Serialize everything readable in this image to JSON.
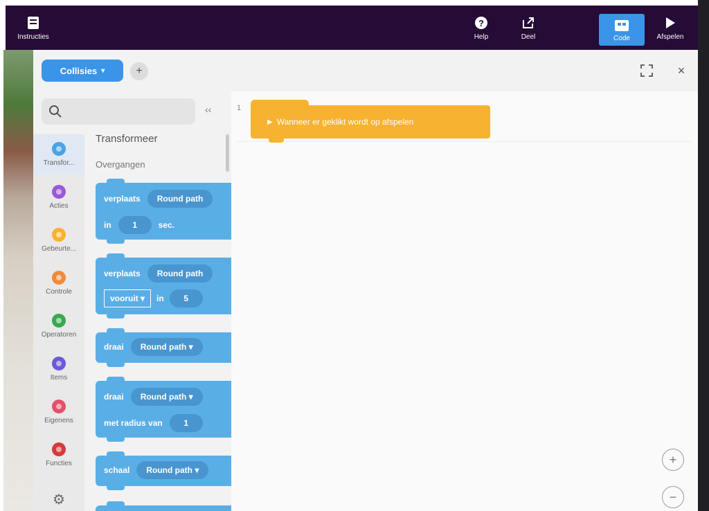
{
  "topbar": {
    "instructions_label": "Instructies",
    "help_label": "Help",
    "share_label": "Deel",
    "code_label": "Code",
    "play_label": "Afspelen"
  },
  "panel": {
    "collection_label": "Collisies",
    "add_label": "+",
    "collapse_label": "‹‹",
    "close_label": "×"
  },
  "categories": [
    {
      "label": "Transfor...",
      "color": "#4aa3e6",
      "selected": true
    },
    {
      "label": "Acties",
      "color": "#9b59d6"
    },
    {
      "label": "Gebeurte...",
      "color": "#f7b230"
    },
    {
      "label": "Controle",
      "color": "#f08a3a"
    },
    {
      "label": "Operatoren",
      "color": "#3aa84f"
    },
    {
      "label": "Items",
      "color": "#6b5ad6"
    },
    {
      "label": "Eigenens",
      "color": "#e6506a"
    },
    {
      "label": "Functies",
      "color": "#d63a3a"
    }
  ],
  "palette": {
    "title": "Transformeer",
    "subtitle": "Overgangen",
    "blocks": [
      {
        "verb": "verplaats",
        "target": "Round path",
        "in": "in",
        "value": "1",
        "unit": "sec."
      },
      {
        "verb": "verplaats",
        "target": "Round path",
        "dir": "vooruit",
        "in": "in",
        "value": "5"
      },
      {
        "verb": "draai",
        "target": "Round path"
      },
      {
        "verb": "draai",
        "target": "Round path",
        "radius_label": "met radius van",
        "value": "1"
      },
      {
        "verb": "schaal",
        "target": "Round path"
      }
    ]
  },
  "canvas": {
    "line_number": "1",
    "event_label": "Wanneer er geklikt wordt op afspelen"
  },
  "zoom": {
    "in_label": "+",
    "out_label": "−"
  },
  "colors": {
    "topbar": "#250b35",
    "accent": "#3a95e8",
    "block_blue": "#5aaee6",
    "event_orange": "#f7b230"
  }
}
